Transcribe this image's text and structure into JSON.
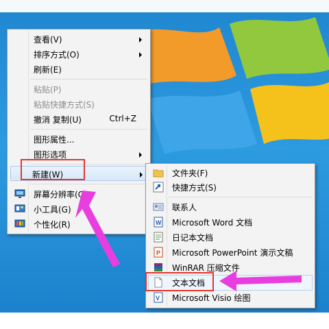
{
  "context_menu": {
    "items": [
      {
        "label": "查看(V)",
        "submenu": true,
        "disabled": false
      },
      {
        "label": "排序方式(O)",
        "submenu": true,
        "disabled": false
      },
      {
        "label": "刷新(E)",
        "submenu": false,
        "disabled": false
      },
      {
        "label": "粘贴(P)",
        "submenu": false,
        "disabled": true
      },
      {
        "label": "粘贴快捷方式(S)",
        "submenu": false,
        "disabled": true
      },
      {
        "label": "撤消 复制(U)",
        "shortcut": "Ctrl+Z",
        "submenu": false,
        "disabled": false
      },
      {
        "label": "图形属性...",
        "submenu": false,
        "disabled": false
      },
      {
        "label": "图形选项",
        "submenu": true,
        "disabled": false
      },
      {
        "label": "新建(W)",
        "submenu": true,
        "disabled": false,
        "highlighted": true
      },
      {
        "label": "屏幕分辨率(C)",
        "icon": "display-icon"
      },
      {
        "label": "小工具(G)",
        "icon": "gadgets-icon"
      },
      {
        "label": "个性化(R)",
        "icon": "personalize-icon"
      }
    ]
  },
  "new_submenu": {
    "items": [
      {
        "label": "文件夹(F)",
        "icon": "folder-icon"
      },
      {
        "label": "快捷方式(S)",
        "icon": "shortcut-icon"
      },
      {
        "label": "联系人",
        "icon": "contact-icon"
      },
      {
        "label": "Microsoft Word 文档",
        "icon": "word-doc-icon"
      },
      {
        "label": "日记本文档",
        "icon": "journal-icon"
      },
      {
        "label": "Microsoft PowerPoint 演示文稿",
        "icon": "powerpoint-icon"
      },
      {
        "label": "WinRAR 压缩文件",
        "icon": "winrar-icon"
      },
      {
        "label": "文本文档",
        "icon": "text-doc-icon",
        "highlighted": true
      },
      {
        "label": "Microsoft Visio 绘图",
        "icon": "visio-icon"
      }
    ]
  },
  "annotations": {
    "box_color": "#e3352b",
    "arrow_color": "#e83ee0"
  }
}
